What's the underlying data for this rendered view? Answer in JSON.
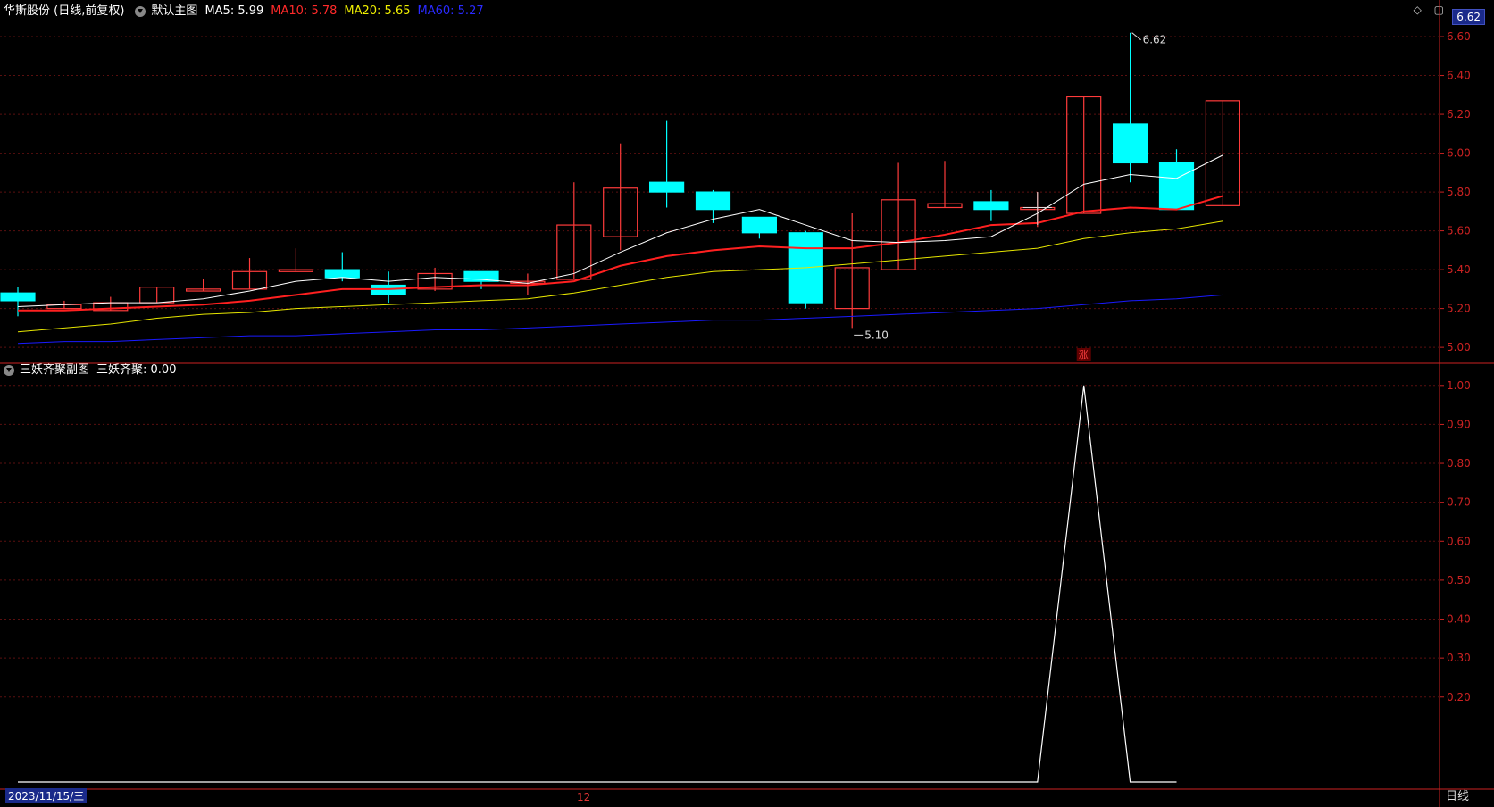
{
  "header": {
    "stock": "华斯股份 (日线,前复权)",
    "template": "默认主图",
    "ma5": "MA5: 5.99",
    "ma10": "MA10: 5.78",
    "ma20": "MA20: 5.65",
    "ma60": "MA60: 5.27"
  },
  "colors": {
    "up": "#ff3b3b",
    "down": "#00ffff",
    "ma5": "#ffffff",
    "ma10": "#ff2020",
    "ma20": "#e6e600",
    "ma60": "#1a1aff",
    "grid": "#5a0f0f",
    "axis": "#cc2222"
  },
  "current_price": "6.62",
  "sub_header": {
    "indicator": "三妖齐聚副图",
    "value": "三妖齐聚: 0.00"
  },
  "price_marks": {
    "high": "6.62",
    "low": "5.10",
    "zhang": "涨"
  },
  "footer": {
    "date": "2023/11/15/三",
    "month_tick": "12",
    "mode": "日线"
  },
  "chart_data": [
    {
      "type": "candlestick",
      "ylim": [
        4.95,
        6.66
      ],
      "yticks": [
        "6.60",
        "6.40",
        "6.20",
        "6.00",
        "5.80",
        "5.60",
        "5.40",
        "5.20",
        "5.00"
      ],
      "candles": [
        {
          "o": 5.28,
          "c": 5.24,
          "h": 5.31,
          "l": 5.16
        },
        {
          "o": 5.2,
          "c": 5.22,
          "h": 5.24,
          "l": 5.2
        },
        {
          "o": 5.19,
          "c": 5.23,
          "h": 5.26,
          "l": 5.19
        },
        {
          "o": 5.23,
          "c": 5.31,
          "h": 5.31,
          "l": 5.23
        },
        {
          "o": 5.29,
          "c": 5.3,
          "h": 5.35,
          "l": 5.29
        },
        {
          "o": 5.3,
          "c": 5.39,
          "h": 5.46,
          "l": 5.3
        },
        {
          "o": 5.39,
          "c": 5.4,
          "h": 5.51,
          "l": 5.39
        },
        {
          "o": 5.4,
          "c": 5.36,
          "h": 5.49,
          "l": 5.34
        },
        {
          "o": 5.32,
          "c": 5.27,
          "h": 5.39,
          "l": 5.23
        },
        {
          "o": 5.3,
          "c": 5.38,
          "h": 5.41,
          "l": 5.29
        },
        {
          "o": 5.39,
          "c": 5.34,
          "h": 5.39,
          "l": 5.3
        },
        {
          "o": 5.33,
          "c": 5.34,
          "h": 5.38,
          "l": 5.27
        },
        {
          "o": 5.35,
          "c": 5.63,
          "h": 5.85,
          "l": 5.35
        },
        {
          "o": 5.57,
          "c": 5.82,
          "h": 6.05,
          "l": 5.5
        },
        {
          "o": 5.85,
          "c": 5.8,
          "h": 6.17,
          "l": 5.72
        },
        {
          "o": 5.8,
          "c": 5.71,
          "h": 5.81,
          "l": 5.64
        },
        {
          "o": 5.67,
          "c": 5.59,
          "h": 5.67,
          "l": 5.56
        },
        {
          "o": 5.59,
          "c": 5.23,
          "h": 5.6,
          "l": 5.2
        },
        {
          "o": 5.2,
          "c": 5.41,
          "h": 5.69,
          "l": 5.1
        },
        {
          "o": 5.4,
          "c": 5.76,
          "h": 5.95,
          "l": 5.4
        },
        {
          "o": 5.72,
          "c": 5.74,
          "h": 5.96,
          "l": 5.72
        },
        {
          "o": 5.75,
          "c": 5.71,
          "h": 5.81,
          "l": 5.65
        },
        {
          "o": 5.71,
          "c": 5.72,
          "h": 5.8,
          "l": 5.62
        },
        {
          "o": 5.69,
          "c": 6.29,
          "h": 6.29,
          "l": 5.69
        },
        {
          "o": 6.15,
          "c": 5.95,
          "h": 6.62,
          "l": 5.85
        },
        {
          "o": 5.95,
          "c": 5.71,
          "h": 6.02,
          "l": 5.71
        },
        {
          "o": 5.73,
          "c": 6.27,
          "h": 6.27,
          "l": 5.73
        }
      ],
      "ma5": [
        5.21,
        5.22,
        5.23,
        5.23,
        5.25,
        5.29,
        5.34,
        5.36,
        5.34,
        5.36,
        5.35,
        5.33,
        5.38,
        5.49,
        5.59,
        5.66,
        5.71,
        5.63,
        5.55,
        5.54,
        5.55,
        5.57,
        5.69,
        5.84,
        5.89,
        5.87,
        5.99
      ],
      "ma10": [
        5.19,
        5.19,
        5.2,
        5.21,
        5.22,
        5.24,
        5.27,
        5.3,
        5.3,
        5.31,
        5.32,
        5.32,
        5.34,
        5.42,
        5.47,
        5.5,
        5.52,
        5.51,
        5.51,
        5.54,
        5.58,
        5.63,
        5.64,
        5.7,
        5.72,
        5.71,
        5.78
      ],
      "ma20": [
        5.08,
        5.1,
        5.12,
        5.15,
        5.17,
        5.18,
        5.2,
        5.21,
        5.22,
        5.23,
        5.24,
        5.25,
        5.28,
        5.32,
        5.36,
        5.39,
        5.4,
        5.41,
        5.43,
        5.45,
        5.47,
        5.49,
        5.51,
        5.56,
        5.59,
        5.61,
        5.65
      ],
      "ma60": [
        5.02,
        5.03,
        5.03,
        5.04,
        5.05,
        5.06,
        5.06,
        5.07,
        5.08,
        5.09,
        5.09,
        5.1,
        5.11,
        5.12,
        5.13,
        5.14,
        5.14,
        5.15,
        5.16,
        5.17,
        5.18,
        5.19,
        5.2,
        5.22,
        5.24,
        5.25,
        5.27
      ]
    },
    {
      "type": "line",
      "ylim": [
        0,
        1.05
      ],
      "yticks": [
        "1.00",
        "0.90",
        "0.80",
        "0.70",
        "0.60",
        "0.50",
        "0.40",
        "0.30",
        "0.20"
      ],
      "values": [
        0,
        0,
        0,
        0,
        0,
        0,
        0,
        0,
        0,
        0,
        0,
        0,
        0,
        0,
        0,
        0,
        0,
        0,
        0,
        0,
        0,
        0,
        0,
        1,
        0,
        0
      ]
    }
  ]
}
